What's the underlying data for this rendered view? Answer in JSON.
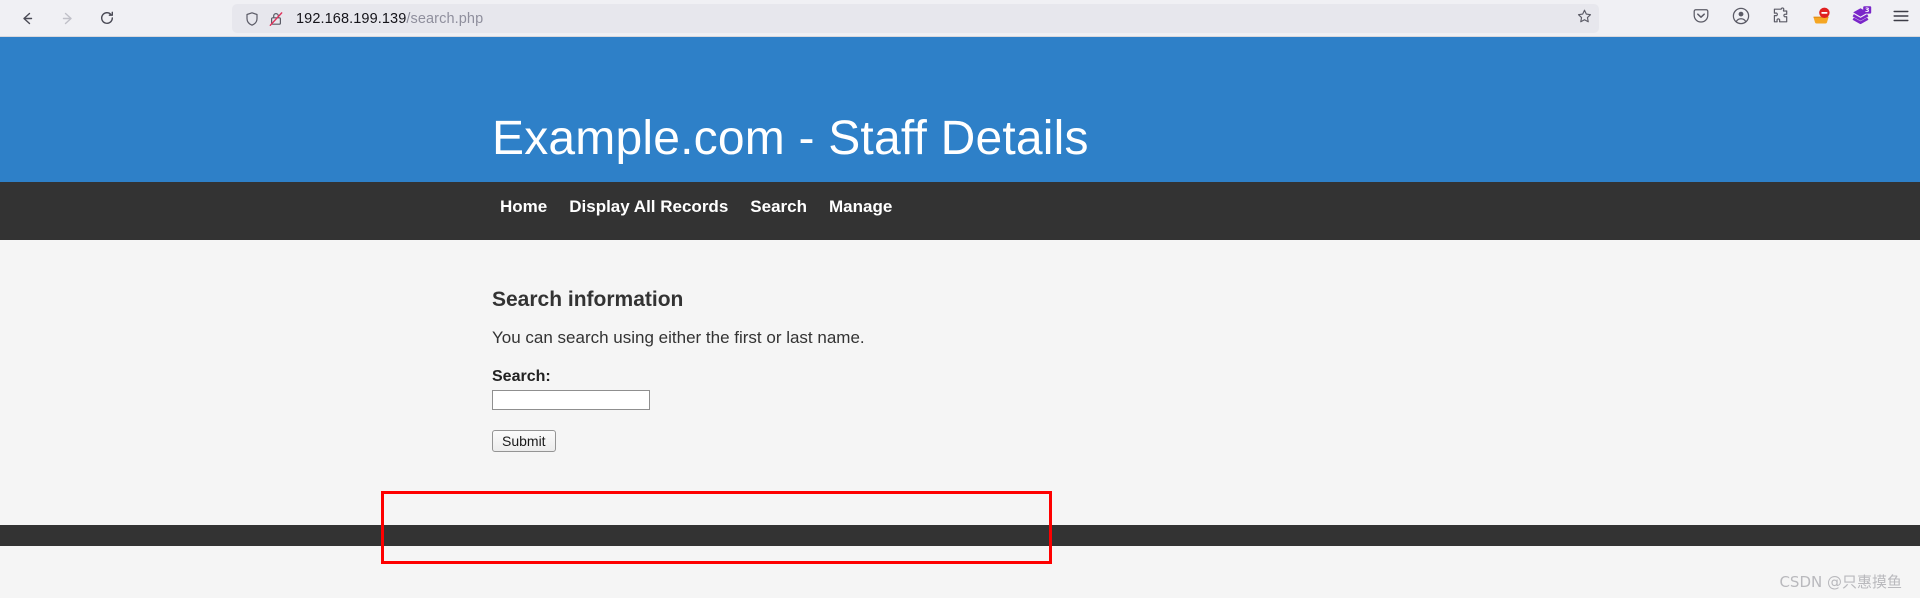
{
  "browser": {
    "back_icon": "back-arrow-icon",
    "forward_icon": "forward-arrow-icon",
    "reload_icon": "reload-icon",
    "shield_icon": "tracking-protection-shield-icon",
    "lock_icon": "insecure-connection-crossed-padlock-icon",
    "url_host": "192.168.199.139",
    "url_path": "/search.php",
    "url_full": "192.168.199.139/search.php",
    "star_icon": "bookmark-star-icon",
    "toolbar_icons": [
      {
        "name": "pocket-save-icon",
        "glyph": "pocket"
      },
      {
        "name": "account-icon",
        "glyph": "account"
      },
      {
        "name": "extensions-puzzle-icon",
        "glyph": "puzzle"
      },
      {
        "name": "adblock-stop-icon",
        "glyph": "adblock",
        "badge": ""
      },
      {
        "name": "downloads-purple-icon",
        "glyph": "purple",
        "badge": "3"
      },
      {
        "name": "application-menu-hamburger-icon",
        "glyph": "hamburger"
      }
    ]
  },
  "page": {
    "title": "Example.com - Staff Details",
    "nav": [
      {
        "label": "Home"
      },
      {
        "label": "Display All Records"
      },
      {
        "label": "Search"
      },
      {
        "label": "Manage"
      }
    ],
    "content": {
      "heading": "Search information",
      "intro": "You can search using either the first or last name.",
      "search_label": "Search:",
      "search_value": "",
      "search_placeholder": "",
      "submit_label": "Submit"
    }
  },
  "annotation": {
    "name": "red-highlight-rectangle",
    "color": "#fe0000"
  },
  "watermark": {
    "text": "CSDN @只惠摸鱼"
  },
  "colors": {
    "header_blue": "#2e80c8",
    "nav_dark": "#333333",
    "page_background": "#f5f5f5",
    "chrome_background": "#f0f0f4",
    "urlbar_background": "#e7e7ed",
    "annotation_red": "#fe0000"
  }
}
